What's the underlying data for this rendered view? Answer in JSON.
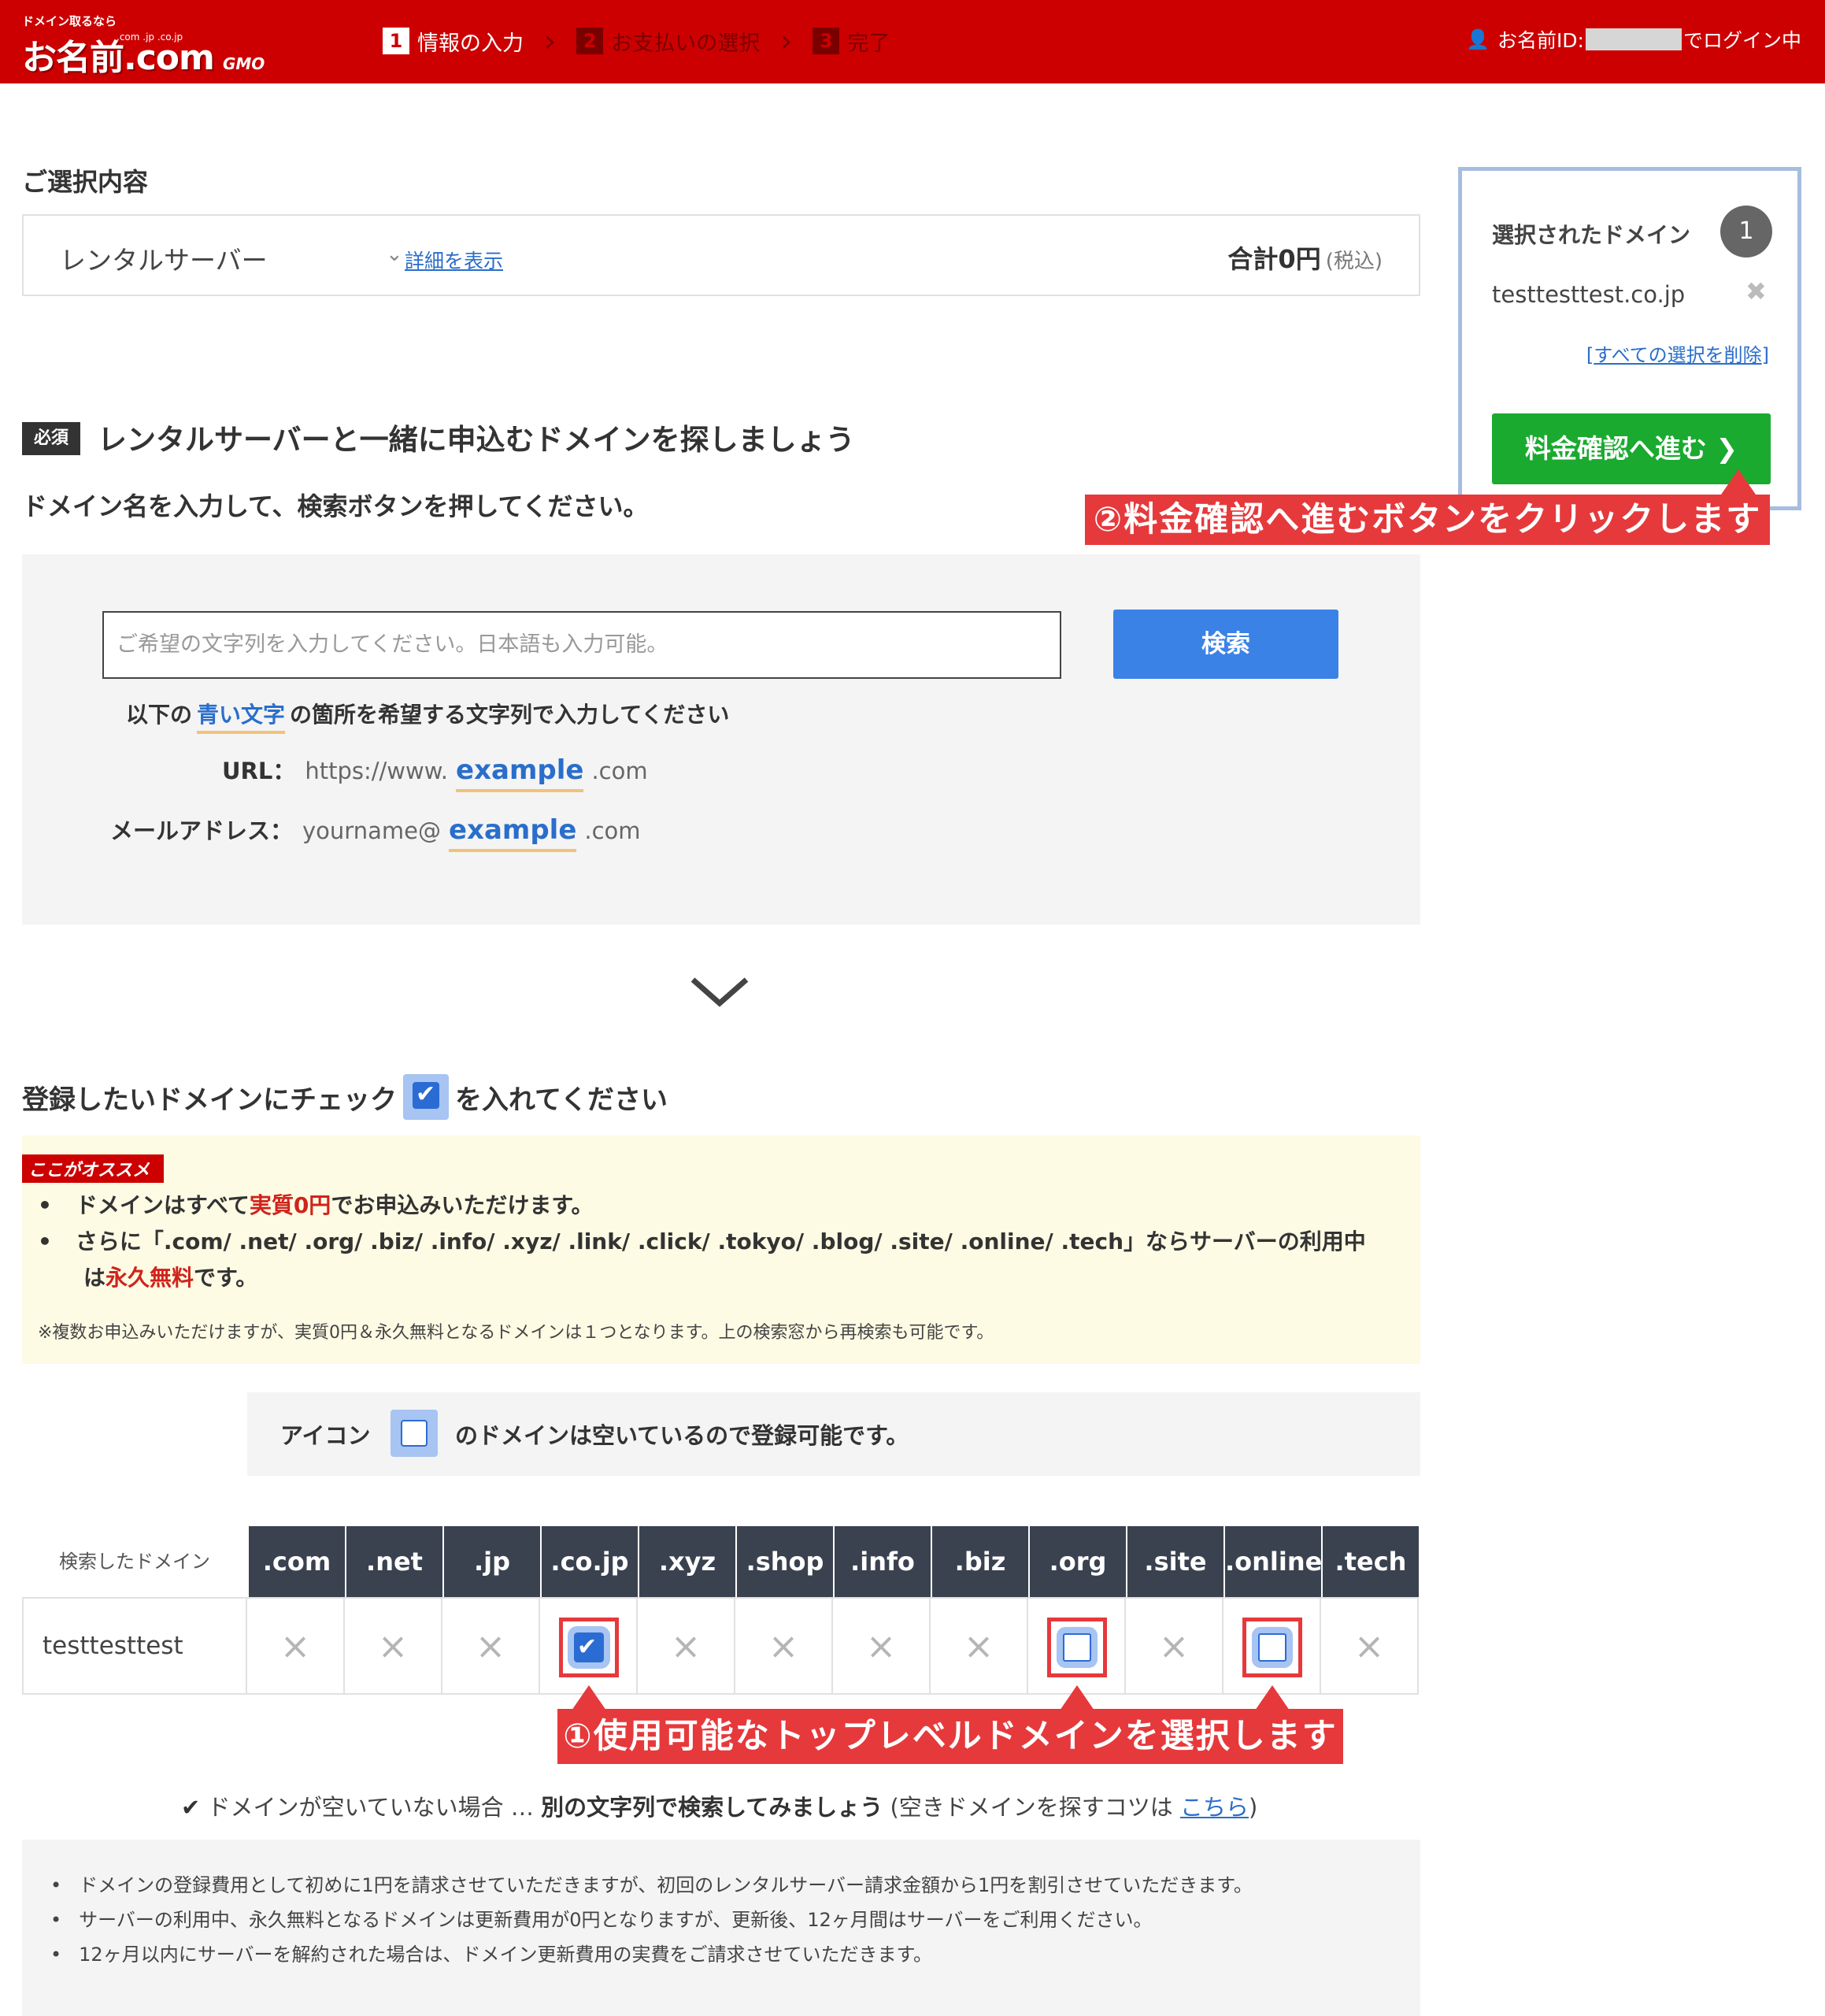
{
  "header": {
    "logo_tagline": "ドメイン取るなら",
    "logo_text": "お名前.com",
    "logo_tlds": ".com .jp .co.jp",
    "logo_gmo": "GMO",
    "steps": [
      {
        "num": "1",
        "label": "情報の入力"
      },
      {
        "num": "2",
        "label": "お支払いの選択"
      },
      {
        "num": "3",
        "label": "完了"
      }
    ],
    "login_prefix": "お名前ID:",
    "login_suffix": "でログイン中"
  },
  "selection": {
    "label": "ご選択内容",
    "product": "レンタルサーバー",
    "detail_link": "詳細を表示",
    "total": "合計0円",
    "tax": "(税込)"
  },
  "sidebar": {
    "title": "選択されたドメイン",
    "count": "1",
    "domain": "testtesttest.co.jp",
    "clear_all": "すべての選択を削除",
    "proceed_button": "料金確認へ進む ❯"
  },
  "annotations": {
    "step2": "②料金確認へ進むボタンをクリックします",
    "step1": "①使用可能なトップレベルドメインを選択します"
  },
  "search": {
    "required_badge": "必須",
    "title": "レンタルサーバーと一緒に申込むドメインを探しましょう",
    "subtitle": "ドメイン名を入力して、検索ボタンを押してください。",
    "placeholder": "ご希望の文字列を入力してください。日本語も入力可能。",
    "button": "検索",
    "hint_before": "以下の",
    "hint_blue": "青い文字",
    "hint_after": "の箇所を希望する文字列で入力してください",
    "url_label": "URL：",
    "url_prefix": "https://www.",
    "url_example": "example",
    "url_suffix": ".com",
    "mail_label": "メールアドレス：",
    "mail_prefix": "yourname@",
    "mail_example": "example",
    "mail_suffix": ".com"
  },
  "check": {
    "title_before": "登録したいドメインにチェック",
    "title_after": "を入れてください",
    "ribbon": "ここがオススメ",
    "bullet1_before": "ドメインはすべて",
    "bullet1_red": "実質0円",
    "bullet1_after": "でお申込みいただけます。",
    "bullet2_line1": "さらに「.com/ .net/ .org/ .biz/ .info/ .xyz/ .link/ .click/ .tokyo/ .blog/ .site/ .online/ .tech」ならサーバーの利用中",
    "bullet2_prefix": "は",
    "bullet2_red": "永久無料",
    "bullet2_after": "です。",
    "note": "※複数お申込みいただけますが、実質0円＆永久無料となるドメインは１つとなります。上の検索窓から再検索も可能です。",
    "legend_before": "アイコン",
    "legend_after": "のドメインは空いているので登録可能です。"
  },
  "table": {
    "header_label": "検索したドメイン",
    "row_label": "testtesttest",
    "tlds": [
      ".com",
      ".net",
      ".jp",
      ".co.jp",
      ".xyz",
      ".shop",
      ".info",
      ".biz",
      ".org",
      ".site",
      ".online",
      ".tech"
    ],
    "status": [
      "x",
      "x",
      "x",
      "checked",
      "x",
      "x",
      "x",
      "x",
      "available",
      "x",
      "available",
      "x"
    ],
    "unavailable_mark": "×"
  },
  "tip": {
    "check": "✔",
    "text1": "ドメインが空いていない場合 … ",
    "bold": "別の文字列で検索してみましょう",
    "text2": " (空きドメインを探すコツは ",
    "link": "こちら",
    "close": ")"
  },
  "notes": [
    "ドメインの登録費用として初めに1円を請求させていただきますが、初回のレンタルサーバー請求金額から1円を割引させていただきます。",
    "サーバーの利用中、永久無料となるドメインは更新費用が0円となりますが、更新後、12ヶ月間はサーバーをご利用ください。",
    "12ヶ月以内にサーバーを解約された場合は、ドメイン更新費用の実費をご請求させていただきます。"
  ],
  "colors": {
    "brand_red": "#cc0000",
    "callout_red": "#e6393c",
    "proceed_green": "#1aaa2f",
    "search_blue": "#3b82e6",
    "table_header": "#3a4250"
  }
}
